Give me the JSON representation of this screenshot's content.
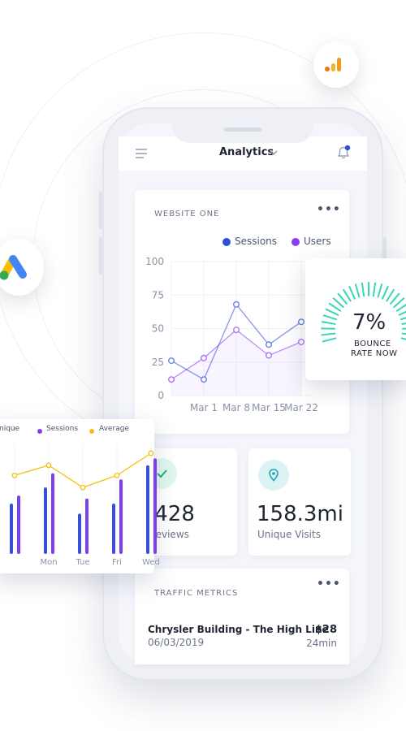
{
  "header": {
    "title": "Analytics"
  },
  "website_card": {
    "title": "WEBSITE ONE",
    "more": "•••",
    "legend": [
      {
        "name": "Sessions",
        "color": "#2f4fd8"
      },
      {
        "name": "Users",
        "color": "#8b3cf2"
      }
    ]
  },
  "bounce": {
    "value": "7%",
    "line1": "BOUNCE",
    "line2": "RATE NOW",
    "color": "#36d6b7"
  },
  "stat_left": {
    "value": ",428",
    "label": "geviews"
  },
  "stat_right": {
    "value": "158.3mi",
    "label": "Unique Visits"
  },
  "traffic": {
    "title": "TRAFFIC METRICS",
    "more": "•••",
    "item": {
      "name": "Chrysler Building - The High Line",
      "date": "06/03/2019",
      "price": "$28",
      "duration": "24min"
    }
  },
  "bar_card": {
    "legend": [
      "nique",
      "Sessions",
      "Average"
    ],
    "days": [
      "Mon",
      "Tue",
      "Fri",
      "Wed"
    ]
  },
  "chart_data": [
    {
      "type": "line",
      "categories": [
        "",
        "Mar 1",
        "Mar 8",
        "Mar 15",
        "Mar 22"
      ],
      "series": [
        {
          "name": "Sessions",
          "values": [
            26,
            12,
            68,
            38,
            55
          ]
        },
        {
          "name": "Users",
          "values": [
            12,
            28,
            49,
            30,
            40
          ]
        }
      ],
      "yticks": [
        0,
        25,
        50,
        75,
        100
      ],
      "ylim": [
        0,
        100
      ]
    },
    {
      "type": "bar",
      "categories": [
        "",
        "Mon",
        "Tue",
        "Fri",
        "Wed"
      ],
      "series": [
        {
          "name": "nique",
          "values": [
            50,
            66,
            40,
            50,
            88
          ]
        },
        {
          "name": "Sessions",
          "values": [
            58,
            80,
            55,
            74,
            95
          ]
        },
        {
          "name": "Average",
          "values": [
            78,
            88,
            66,
            78,
            100
          ]
        }
      ],
      "ylim": [
        0,
        100
      ]
    }
  ]
}
